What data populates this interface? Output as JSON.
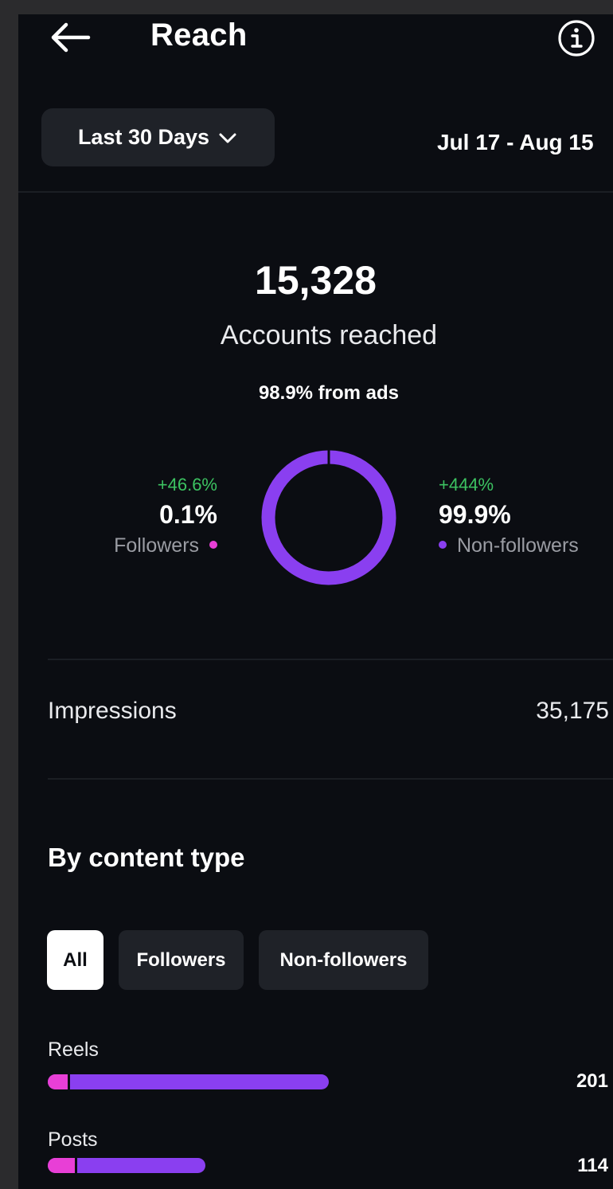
{
  "header": {
    "title": "Reach",
    "back_icon": "arrow-left-icon",
    "info_icon": "info-icon"
  },
  "filter": {
    "range_label": "Last 30 Days",
    "date_range": "Jul 17 - Aug 15"
  },
  "summary": {
    "accounts_reached": "15,328",
    "accounts_label": "Accounts reached",
    "ads_share": "98.9% from ads"
  },
  "audience": {
    "followers": {
      "delta": "+46.6%",
      "percent": "0.1%",
      "label": "Followers",
      "color": "#e83fd6",
      "share": 0.001
    },
    "non_followers": {
      "delta": "+444%",
      "percent": "99.9%",
      "label": "Non-followers",
      "color": "#8a3ff0",
      "share": 0.999
    }
  },
  "impressions": {
    "label": "Impressions",
    "value": "35,175"
  },
  "content_type": {
    "title": "By content type",
    "chips": [
      "All",
      "Followers",
      "Non-followers"
    ],
    "active_chip": "All",
    "rows": [
      {
        "label": "Reels",
        "value": "201",
        "followers_fraction": 0.07
      },
      {
        "label": "Posts",
        "value": "114",
        "followers_fraction": 0.17
      }
    ]
  },
  "colors": {
    "background": "#0b0d12",
    "followers": "#e83fd6",
    "non_followers": "#8a3ff0",
    "delta_positive": "#3cc261"
  }
}
